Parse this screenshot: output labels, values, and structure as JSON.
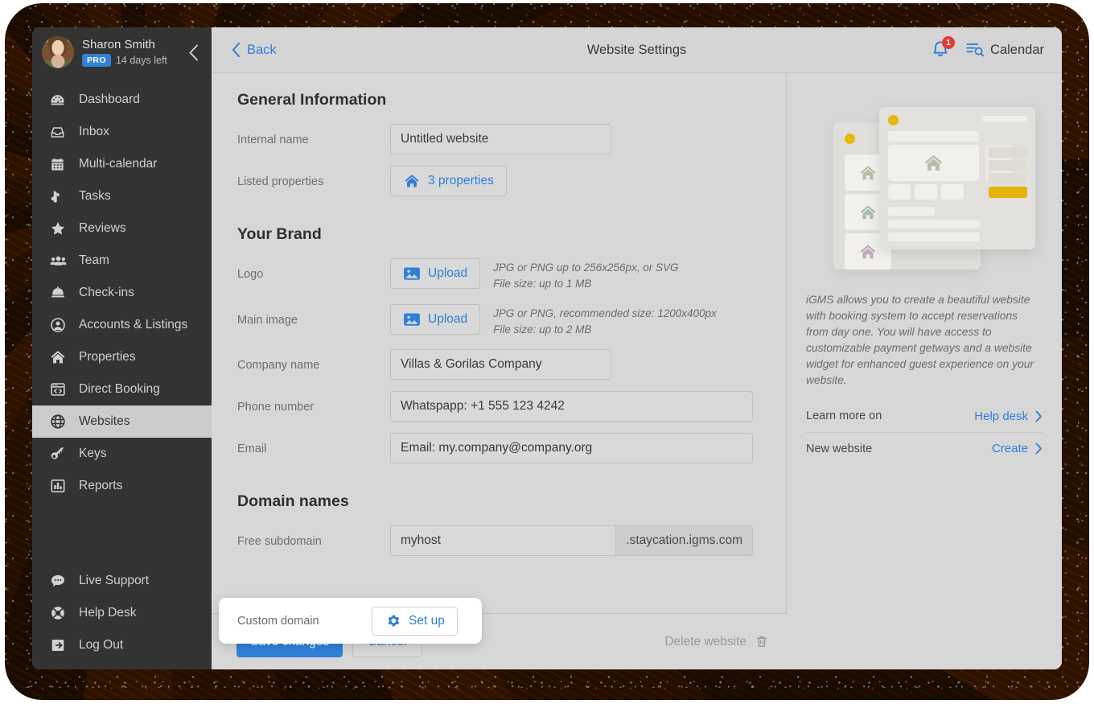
{
  "sidebar": {
    "user": {
      "name": "Sharon Smith",
      "badge": "PRO",
      "trial": "14 days left"
    },
    "items": [
      {
        "label": "Dashboard",
        "icon": "dashboard-icon"
      },
      {
        "label": "Inbox",
        "icon": "inbox-icon"
      },
      {
        "label": "Multi-calendar",
        "icon": "calendar-icon"
      },
      {
        "label": "Tasks",
        "icon": "tasks-icon"
      },
      {
        "label": "Reviews",
        "icon": "star-icon"
      },
      {
        "label": "Team",
        "icon": "people-icon"
      },
      {
        "label": "Check-ins",
        "icon": "bell-desk-icon"
      },
      {
        "label": "Accounts & Listings",
        "icon": "user-circle-icon"
      },
      {
        "label": "Properties",
        "icon": "home-icon"
      },
      {
        "label": "Direct Booking",
        "icon": "code-window-icon"
      },
      {
        "label": "Websites",
        "icon": "globe-icon",
        "active": true
      },
      {
        "label": "Keys",
        "icon": "key-icon"
      },
      {
        "label": "Reports",
        "icon": "bar-chart-icon"
      }
    ],
    "bottom_items": [
      {
        "label": "Live Support",
        "icon": "chat-icon"
      },
      {
        "label": "Help Desk",
        "icon": "lifebuoy-icon"
      },
      {
        "label": "Log Out",
        "icon": "logout-icon"
      }
    ]
  },
  "topbar": {
    "back_label": "Back",
    "title": "Website Settings",
    "notification_count": "1",
    "calendar_label": "Calendar"
  },
  "form": {
    "general": {
      "title": "General Information",
      "internal_name_label": "Internal name",
      "internal_name_value": "Untitled website",
      "listed_properties_label": "Listed properties",
      "listed_properties_value": "3 properties"
    },
    "brand": {
      "title": "Your Brand",
      "logo_label": "Logo",
      "logo_button": "Upload",
      "logo_hint_1": "JPG or PNG up to 256x256px, or SVG",
      "logo_hint_2": "File size: up to 1 MB",
      "main_image_label": "Main image",
      "main_image_button": "Upload",
      "main_image_hint_1": "JPG or PNG, recommended size: 1200x400px",
      "main_image_hint_2": "File size: up to 2 MB",
      "company_label": "Company name",
      "company_value": "Villas & Gorilas Company",
      "phone_label": "Phone number",
      "phone_value": "Whatspapp: +1 555 123 4242",
      "email_label": "Email",
      "email_value": "Email: my.company@company.org"
    },
    "domains": {
      "title": "Domain names",
      "free_subdomain_label": "Free subdomain",
      "free_subdomain_value": "myhost",
      "free_subdomain_suffix": ".staycation.igms.com",
      "custom_domain_label": "Custom domain",
      "custom_domain_button": "Set up"
    },
    "actions": {
      "save_label": "Save changes",
      "cancel_label": "Cancel",
      "delete_label": "Delete website"
    }
  },
  "info": {
    "blurb": "iGMS allows you to create a beautiful website with booking system to accept reservations from day one. You will have access to customizable payment getways and a website widget for enhanced guest experience on your website.",
    "learn_more_label": "Learn more on",
    "help_desk_label": "Help desk",
    "new_website_label": "New website",
    "create_label": "Create"
  },
  "colors": {
    "accent_blue": "#2f80d8",
    "badge_red": "#e03b36",
    "sidebar_bg": "#333333",
    "app_bg": "#d7d7d7",
    "illustration_yellow": "#e5b408"
  }
}
